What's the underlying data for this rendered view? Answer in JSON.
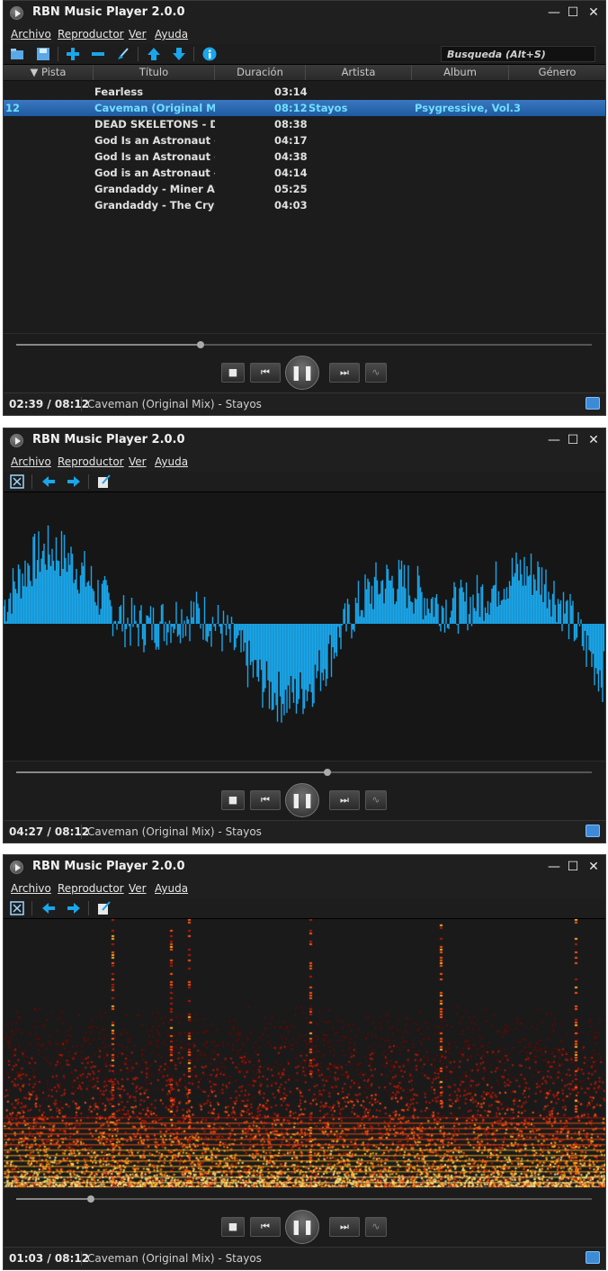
{
  "app": {
    "title": "RBN Music Player 2.0.0",
    "min_glyph": "—",
    "max_glyph": "☐",
    "close_glyph": "✕"
  },
  "menu": [
    "Archivo",
    "Reproductor",
    "Ver",
    "Ayuda"
  ],
  "search": {
    "placeholder": "Busqueda  (Alt+S)"
  },
  "playlist": {
    "columns": [
      "Pista",
      "Título",
      "Duración",
      "Artista",
      "Album",
      "Género"
    ],
    "rows": [
      {
        "pista": "",
        "titulo": "Fearless",
        "duracion": "03:14",
        "artista": "",
        "album": ""
      },
      {
        "pista": "12",
        "titulo": "Caveman (Original Mix)",
        "duracion": "08:12",
        "artista": "Stayos",
        "album": "Psygressive, Vol.3",
        "selected": true
      },
      {
        "pista": "",
        "titulo": "DEAD SKELETONS - D...",
        "duracion": "08:38",
        "artista": "",
        "album": ""
      },
      {
        "pista": "",
        "titulo": "God Is an Astronaut - ...",
        "duracion": "04:17",
        "artista": "",
        "album": ""
      },
      {
        "pista": "",
        "titulo": "God Is an Astronaut - ...",
        "duracion": "04:38",
        "artista": "",
        "album": ""
      },
      {
        "pista": "",
        "titulo": "God is an Astronaut - ...",
        "duracion": "04:14",
        "artista": "",
        "album": ""
      },
      {
        "pista": "",
        "titulo": "Grandaddy - Miner At ...",
        "duracion": "05:25",
        "artista": "",
        "album": ""
      },
      {
        "pista": "",
        "titulo": "Grandaddy - The Cryst...",
        "duracion": "04:03",
        "artista": "",
        "album": ""
      }
    ]
  },
  "controls": {
    "stop": "■",
    "prev": "⏮",
    "pause": "❚❚",
    "next": "⏭",
    "viz": "∿"
  },
  "windows": [
    {
      "view": "playlist",
      "time": "02:39 / 08:12",
      "progress": 0.32
    },
    {
      "view": "waveform",
      "time": "04:27 / 08:12",
      "progress": 0.54
    },
    {
      "view": "spectrogram",
      "time": "01:03 / 08:12",
      "progress": 0.13
    }
  ],
  "now_playing": "Caveman (Original Mix) - Stayos",
  "colors": {
    "accent": "#1aa6ea",
    "selection": "#2a6db5",
    "selection_text": "#6fe0ff"
  }
}
